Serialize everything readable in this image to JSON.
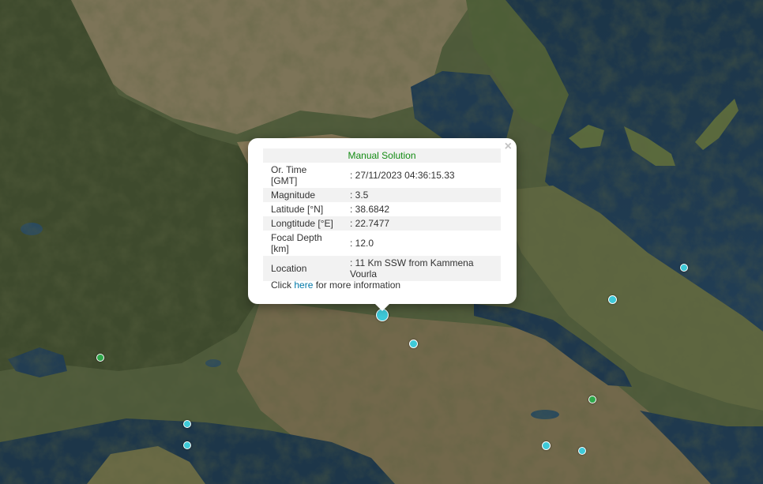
{
  "map": {
    "markers": [
      {
        "kind": "selected",
        "color": "#3ec9d8"
      },
      {
        "kind": "event",
        "color": "#3ec9d8"
      },
      {
        "kind": "event",
        "color": "#3ec9d8"
      },
      {
        "kind": "event",
        "color": "#3ec9d8"
      },
      {
        "kind": "event",
        "color": "#2fa84b"
      },
      {
        "kind": "event",
        "color": "#3ec9d8"
      },
      {
        "kind": "event",
        "color": "#3ec9d8"
      },
      {
        "kind": "event",
        "color": "#2fa84b"
      },
      {
        "kind": "event",
        "color": "#3ec9d8"
      },
      {
        "kind": "event",
        "color": "#3ec9d8"
      }
    ]
  },
  "popup": {
    "close_symbol": "×",
    "title": "Manual Solution",
    "rows": [
      {
        "label": "Or. Time [GMT]",
        "value": ": 27/11/2023 04:36:15.33"
      },
      {
        "label": "Magnitude",
        "value": ": 3.5"
      },
      {
        "label": "Latitude [°N]",
        "value": ": 38.6842"
      },
      {
        "label": "Longtitude [°E]",
        "value": ": 22.7477"
      },
      {
        "label": "Focal Depth [km]",
        "value": ": 12.0"
      },
      {
        "label": "Location",
        "value": ": 11 Km SSW from Kammena Vourla"
      }
    ],
    "footer_prefix": "Click ",
    "footer_link": "here",
    "footer_suffix": " for more information"
  }
}
